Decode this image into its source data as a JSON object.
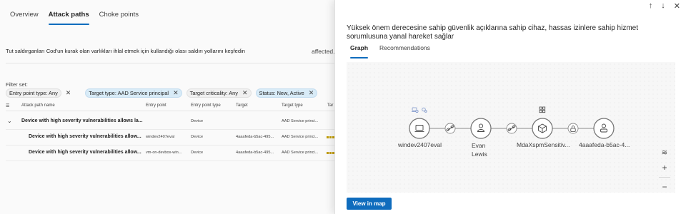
{
  "left": {
    "tabs": [
      "Overview",
      "Attack paths",
      "Choke points"
    ],
    "description": "Tut saldırganları Cod'un kurak olan varlıkları ihlal etmek için kullandığı olası saldırı yollarını keşfedin",
    "affected_text": "affected.",
    "filter_label": "Filter set:",
    "filters": [
      {
        "label": "Entry point type: Any"
      },
      {
        "label": "Target type: AAD Service principal"
      },
      {
        "label": "Target criticality: Any"
      },
      {
        "label": "Status: New, Active"
      }
    ],
    "close_glyph": "✕",
    "columns": [
      "Attack path name",
      "Entry point",
      "Entry point type",
      "Target",
      "Target type",
      "Tar"
    ],
    "group_row": {
      "name": "Device with high severity vulnerabilities allows la...",
      "entry_type": "Device",
      "target_type": "AAD Service princi..."
    },
    "rows": [
      {
        "name": "Device with high severity vulnerabilities allow...",
        "entry_point": "windev2407eval",
        "entry_type": "Device",
        "target": "4aaafeda-b5ac-495...",
        "target_type": "AAD Service princi..."
      },
      {
        "name": "Device with high severity vulnerabilities allow...",
        "entry_point": "vm-on-devbox-win...",
        "entry_type": "Device",
        "target": "4aaafeda-b5ac-495...",
        "target_type": "AAD Service princi..."
      }
    ]
  },
  "panel": {
    "controls": {
      "up": "↑",
      "down": "↓",
      "close": "✕"
    },
    "title": "Yüksek önem derecesine sahip güvenlik açıklarına sahip cihaz, hassas izinlere sahip hizmet sorumlusuna yanal hareket sağlar",
    "tabs": [
      "Graph",
      "Recommendations"
    ],
    "graph": {
      "nodes": [
        {
          "label": "windev2407eval",
          "icon": "device-icon"
        },
        {
          "label": "Evan\nLewis",
          "icon": "user-icon"
        },
        {
          "label": "MdaXspmSensitiv...",
          "icon": "cube-icon"
        },
        {
          "label": "4aaafeda-b5ac-4...",
          "icon": "service-principal-icon"
        }
      ],
      "edges": [
        {
          "icon": "link-icon"
        },
        {
          "icon": "link-icon"
        },
        {
          "icon": "lock-icon"
        }
      ]
    },
    "zoom": {
      "layers": "≋",
      "zoom_in": "+",
      "zoom_out": "−"
    },
    "view_in_map": "View in map"
  },
  "colors": {
    "accent": "#0f6cbd",
    "filter_highlight": "#d8ebf7",
    "criticality_bar": "#c19c00"
  }
}
